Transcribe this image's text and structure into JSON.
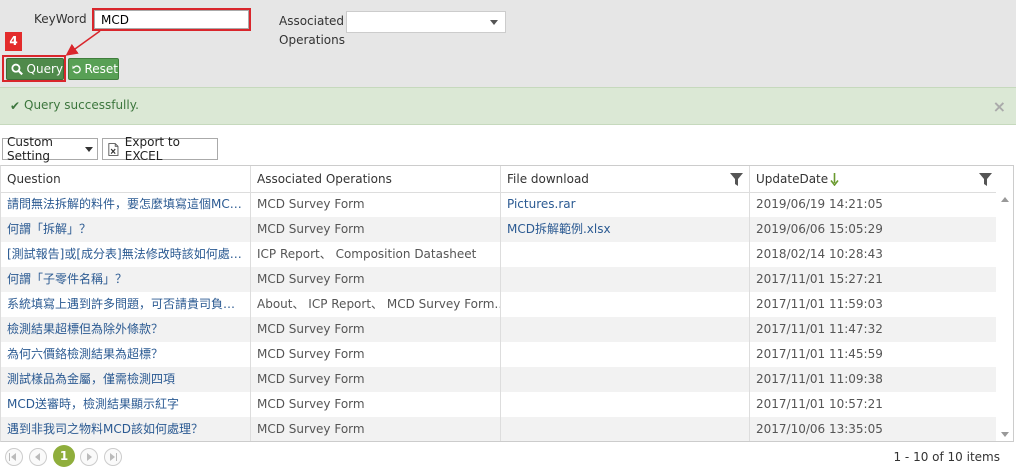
{
  "search": {
    "keyword_label": "KeyWord",
    "keyword_value": "MCD",
    "assoc_label_line1": "Associated",
    "assoc_label_line2": "Operations",
    "assoc_selected": "",
    "step_badge": "4",
    "query_label": "Query",
    "reset_label": "Reset"
  },
  "alert": {
    "message": "Query successfully.",
    "close": "×"
  },
  "toolbar": {
    "custom_setting": "Custom Setting",
    "export": "Export to EXCEL"
  },
  "grid": {
    "columns": [
      "Question",
      "Associated Operations",
      "File download",
      "UpdateDate"
    ],
    "rows": [
      {
        "question": "請問無法拆解的料件，要怎麼填寫這個MC…",
        "ops": "MCD Survey Form",
        "file": "Pictures.rar",
        "date": "2019/06/19 14:21:05"
      },
      {
        "question": "何謂「拆解」？",
        "ops": "MCD Survey Form",
        "file": "MCD拆解範例.xlsx",
        "date": "2019/06/06 15:05:29"
      },
      {
        "question": "[測試報告]或[成分表]無法修改時該如何處…",
        "ops": "ICP Report、 Composition Datasheet",
        "file": "",
        "date": "2018/02/14 10:28:43"
      },
      {
        "question": "何謂「子零件名稱」？",
        "ops": "MCD Survey Form",
        "file": "",
        "date": "2017/11/01 15:27:21"
      },
      {
        "question": "系統填寫上遇到許多問題，可否請貴司負…",
        "ops": "About、 ICP Report、 MCD Survey Form…",
        "file": "",
        "date": "2017/11/01 11:59:03"
      },
      {
        "question": "檢測結果超標但為除外條款？",
        "ops": "MCD Survey Form",
        "file": "",
        "date": "2017/11/01 11:47:32"
      },
      {
        "question": "為何六價鉻檢測結果為超標？",
        "ops": "MCD Survey Form",
        "file": "",
        "date": "2017/11/01 11:45:59"
      },
      {
        "question": "測試樣品為金屬，僅需檢測四項",
        "ops": "MCD Survey Form",
        "file": "",
        "date": "2017/11/01 11:09:38"
      },
      {
        "question": "MCD送審時，檢測結果顯示紅字",
        "ops": "MCD Survey Form",
        "file": "",
        "date": "2017/11/01 10:57:21"
      },
      {
        "question": "遇到非我司之物料MCD該如何處理？",
        "ops": "MCD Survey Form",
        "file": "",
        "date": "2017/10/06 13:35:05"
      }
    ]
  },
  "pager": {
    "current": "1",
    "info": "1 - 10 of 10 items"
  },
  "colors": {
    "accent_red": "#d9262c",
    "button_green": "#4f8a4b",
    "alert_bg": "#dbe8d5",
    "link": "#2b5a92",
    "sort_arrow": "#6a9a2f"
  }
}
